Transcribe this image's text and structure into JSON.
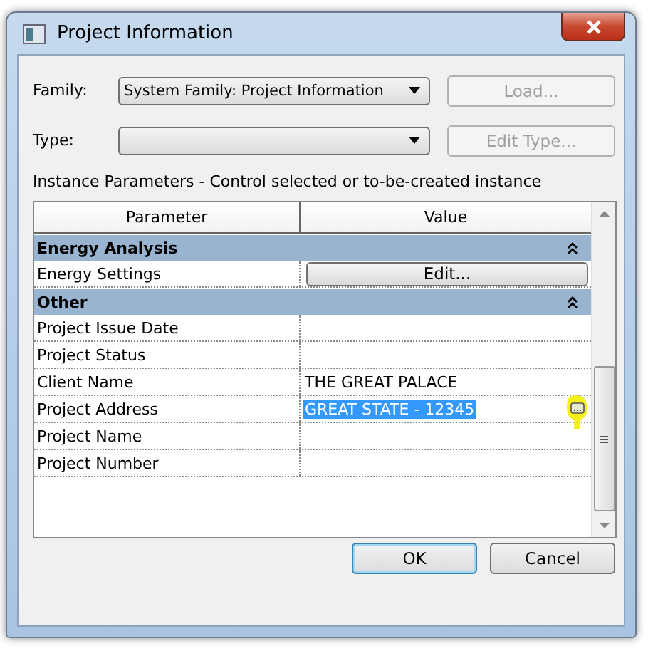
{
  "window": {
    "title": "Project Information"
  },
  "family": {
    "label": "Family:",
    "value": "System Family: Project Information"
  },
  "type": {
    "label": "Type:"
  },
  "load_button": {
    "label": "Load...",
    "disabled": true
  },
  "edit_type_button": {
    "label": "Edit Type...",
    "disabled": true
  },
  "instance_label": "Instance Parameters - Control selected or to-be-created instance",
  "table": {
    "columns": [
      "Parameter",
      "Value"
    ],
    "groups": [
      {
        "name": "Energy Analysis",
        "expanded": true,
        "rows": [
          {
            "parameter": "Energy Settings",
            "kind": "button",
            "value": "Edit..."
          }
        ]
      },
      {
        "name": "Other",
        "expanded": true,
        "rows": [
          {
            "parameter": "Project Issue Date",
            "kind": "text",
            "selected": false
          },
          {
            "parameter": "Project Status",
            "kind": "text",
            "selected": false
          },
          {
            "parameter": "Client Name",
            "kind": "text",
            "value": "THE GREAT PALACE",
            "selected": false
          },
          {
            "parameter": "Project Address",
            "kind": "text",
            "value": "GREAT STATE - 12345",
            "selected": true
          },
          {
            "parameter": "Project Name",
            "kind": "text",
            "selected": false
          },
          {
            "parameter": "Project Number",
            "kind": "text",
            "selected": false
          }
        ]
      }
    ]
  },
  "buttons": [
    {
      "label": "OK",
      "default": true
    },
    {
      "label": "Cancel",
      "default": false
    }
  ]
}
